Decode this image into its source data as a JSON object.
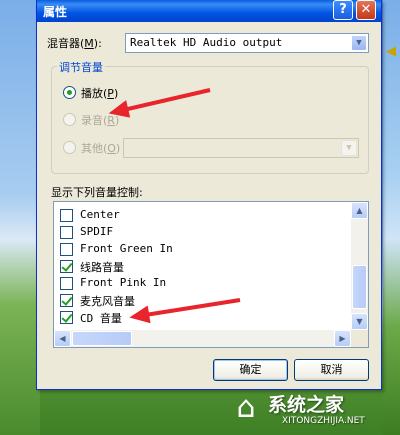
{
  "window": {
    "title": "属性",
    "help_glyph": "?",
    "close_glyph": "✕"
  },
  "mixer": {
    "label": "混音器",
    "accel": "M",
    "value": "Realtek HD Audio output"
  },
  "volume_group": {
    "title": "调节音量",
    "options": [
      {
        "label": "播放",
        "accel": "P",
        "checked": true,
        "enabled": true
      },
      {
        "label": "录音",
        "accel": "R",
        "checked": false,
        "enabled": false
      },
      {
        "label": "其他",
        "accel": "O",
        "checked": false,
        "enabled": false
      }
    ]
  },
  "controls": {
    "label": "显示下列音量控制:",
    "items": [
      {
        "label": "Center",
        "checked": false
      },
      {
        "label": "SPDIF",
        "checked": false
      },
      {
        "label": "Front Green In",
        "checked": false
      },
      {
        "label": "线路音量",
        "checked": true
      },
      {
        "label": "Front Pink In",
        "checked": false
      },
      {
        "label": "麦克风音量",
        "checked": true
      },
      {
        "label": "CD 音量",
        "checked": true
      }
    ]
  },
  "buttons": {
    "ok": "确定",
    "cancel": "取消"
  },
  "watermark": {
    "title": "系统之家",
    "url": "XITONGZHIJIA.NET"
  },
  "colors": {
    "annotation_arrow": "#e8242c",
    "titlebar": "#0054e3",
    "dialog_bg": "#ece9d8"
  }
}
